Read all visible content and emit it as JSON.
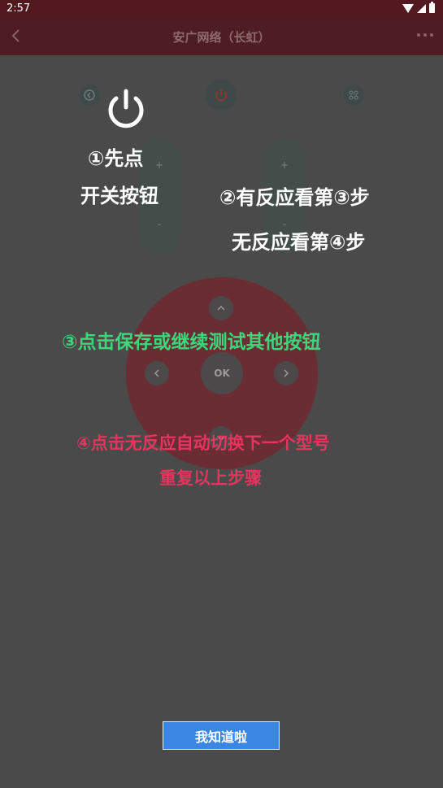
{
  "status_bar": {
    "time": "2:57"
  },
  "toolbar": {
    "title": "安广网络（长虹）"
  },
  "remote": {
    "ok_label": "OK",
    "vol_plus": "+",
    "vol_minus": "-",
    "ch_plus": "+",
    "ch_minus": "-"
  },
  "guide": {
    "step1_line1": "①先点",
    "step1_line2": "开关按钮",
    "step2_line1": "②有反应看第③步",
    "step2_line2": "无反应看第④步",
    "step3": "③点击保存或继续测试其他按钮",
    "step4_line1": "④点击无反应自动切换下一个型号",
    "step4_line2": "重复以上步骤",
    "confirm_button": "我知道啦"
  },
  "colors": {
    "overlay": "#4a4a4a",
    "guide_white": "#ffffff",
    "guide_green": "#3ed67a",
    "guide_pink": "#e5355e",
    "button_blue": "#3b86e2"
  }
}
